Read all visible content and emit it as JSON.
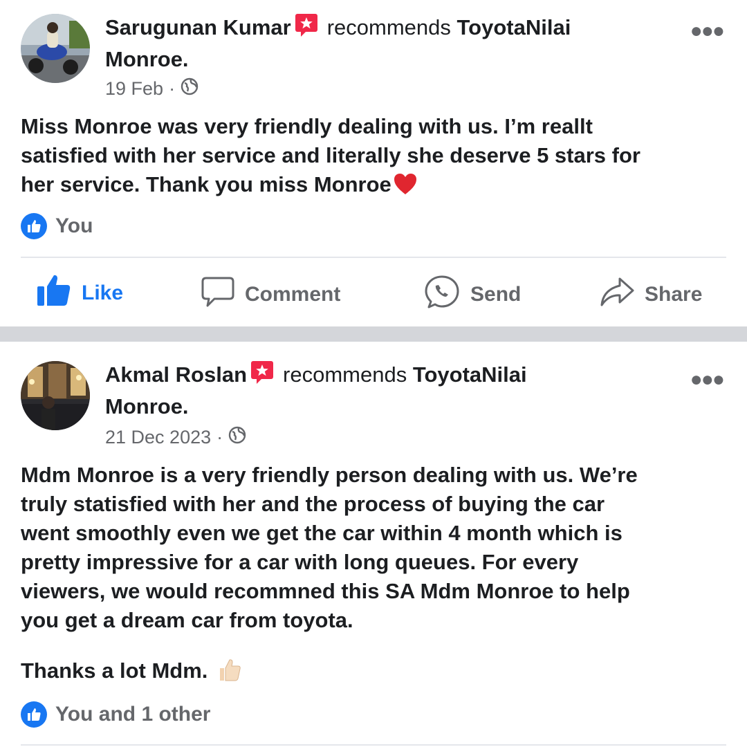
{
  "posts": [
    {
      "author": "Sarugunan Kumar",
      "verb": "recommends",
      "page_line1": "ToyotaNilai",
      "page_line2": "Monroe.",
      "date": "19 Feb",
      "body": [
        "Miss Monroe was very friendly dealing with us. I’m reallt",
        "satisfied with her service and literally she deserve 5 stars for",
        "her service. Thank you miss Monroe"
      ],
      "body_emoji": "red-heart-emoji",
      "reactions": "You",
      "actions": {
        "like": "Like",
        "comment": "Comment",
        "send": "Send",
        "share": "Share"
      }
    },
    {
      "author": "Akmal Roslan",
      "verb": "recommends",
      "page_line1": "ToyotaNilai",
      "page_line2": "Monroe.",
      "date": "21 Dec 2023",
      "body": [
        "Mdm Monroe is a very friendly person dealing with us. We’re",
        "truly statisfied with her and the process of buying the car",
        "went smoothly even we get the car within 4 month which is",
        "pretty impressive for a car with long queues. For every",
        "viewers, we would recommned this SA Mdm Monroe to help",
        "you get a dream car from toyota."
      ],
      "body_last": "Thanks a lot Mdm.",
      "body_emoji": "thumbs-up-emoji",
      "reactions": "You and 1 other"
    }
  ],
  "colors": {
    "accent": "#1877f2",
    "secondary_text": "#65676b",
    "badge": "#f02849",
    "separator": "#d4d6da"
  },
  "icons": [
    "recommend-badge-icon",
    "globe-icon",
    "more-options-icon",
    "like-reaction-icon",
    "like-icon",
    "comment-icon",
    "send-icon",
    "share-icon"
  ]
}
